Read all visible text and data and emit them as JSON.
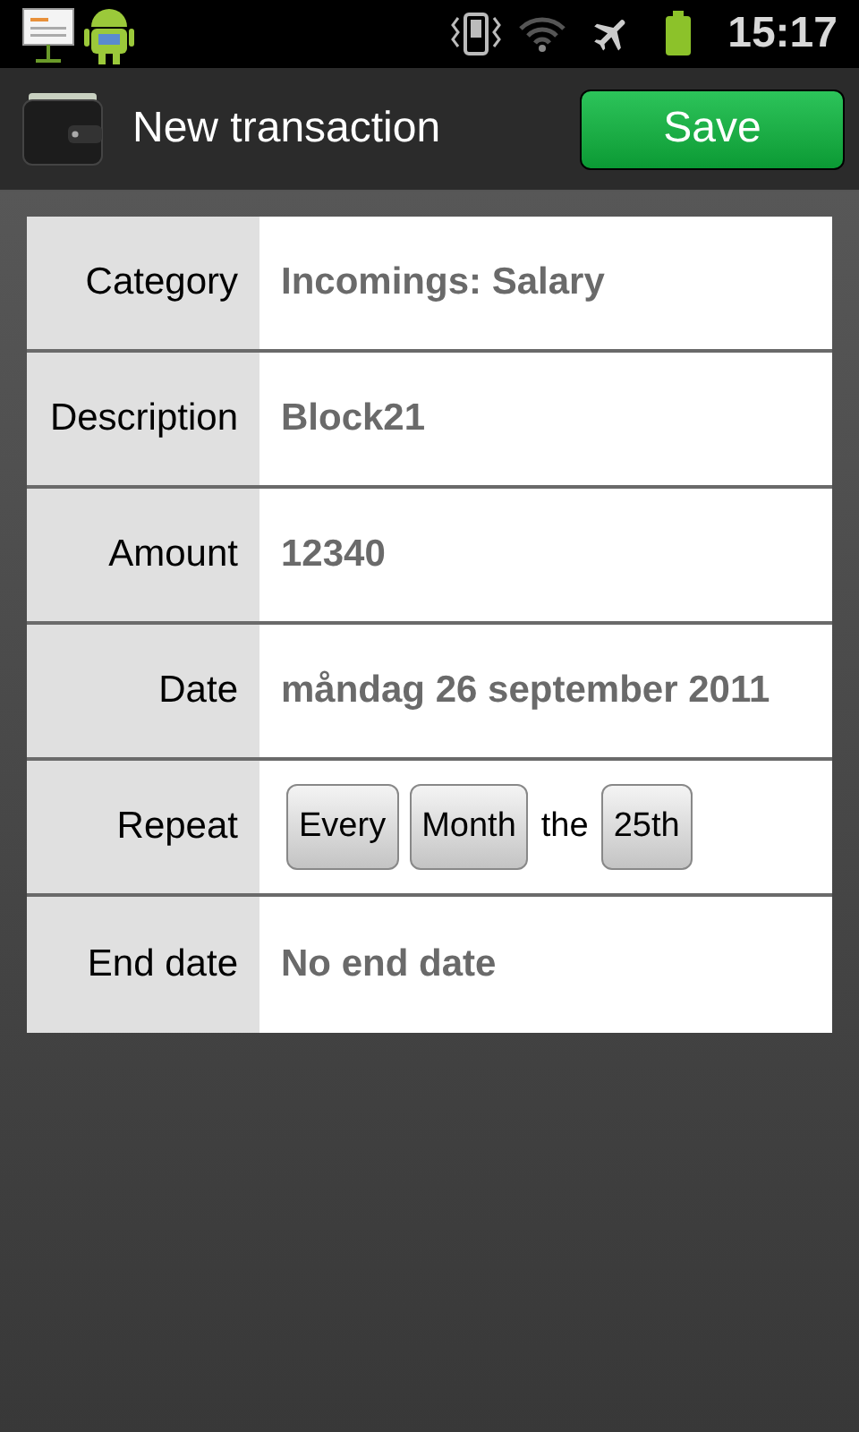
{
  "status_bar": {
    "time": "15:17"
  },
  "title_bar": {
    "title": "New transaction",
    "save_button": "Save"
  },
  "rows": [
    {
      "kind": "value",
      "label": "Category",
      "value": "Incomings: Salary"
    },
    {
      "kind": "value",
      "label": "Description",
      "value": "Block21"
    },
    {
      "kind": "value",
      "label": "Amount",
      "value": "12340"
    },
    {
      "kind": "value",
      "label": "Date",
      "value": "måndag 26 september 2011"
    },
    {
      "kind": "repeat",
      "label": "Repeat",
      "parts": [
        {
          "kind": "button",
          "label": "Every"
        },
        {
          "kind": "button",
          "label": "Month"
        },
        {
          "kind": "text",
          "label": "the"
        },
        {
          "kind": "button",
          "label": "25th"
        }
      ]
    },
    {
      "kind": "value",
      "label": "End date",
      "value": "No end date"
    }
  ]
}
